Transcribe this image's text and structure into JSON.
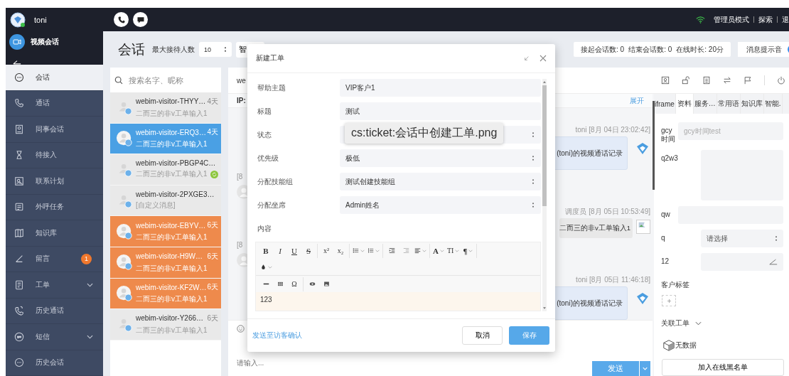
{
  "topbar": {
    "user": "toni",
    "menu": [
      {
        "label": "管理员模式"
      },
      {
        "label": "探索"
      },
      {
        "label": "退"
      }
    ]
  },
  "sidebar": {
    "video": "视频会话",
    "items": [
      {
        "label": "会话",
        "selected": true,
        "submenu": false
      },
      {
        "label": "通话",
        "selected": false,
        "submenu": false
      },
      {
        "label": "同事会话",
        "selected": false,
        "submenu": false
      },
      {
        "label": "待接入",
        "selected": false,
        "submenu": false
      },
      {
        "label": "联系计划",
        "selected": false,
        "submenu": false
      },
      {
        "label": "外呼任务",
        "selected": false,
        "submenu": false
      },
      {
        "label": "知识库",
        "selected": false,
        "submenu": false
      },
      {
        "label": "留言",
        "selected": false,
        "submenu": false,
        "badge": "1"
      },
      {
        "label": "工单",
        "selected": false,
        "submenu": true
      },
      {
        "label": "历史通话",
        "selected": false,
        "submenu": false
      },
      {
        "label": "短信",
        "selected": false,
        "submenu": true
      },
      {
        "label": "历史会话",
        "selected": false,
        "submenu": false
      }
    ]
  },
  "header": {
    "title": "会话",
    "max_label": "最大接待人数",
    "max_value": "10",
    "smart": "智",
    "stats": [
      "接起会话数: 0",
      "结束会话数: 0",
      "在线时长: 20分"
    ],
    "sound_label": "消息提示音",
    "sound_on": true
  },
  "conversations": {
    "search_placeholder": "搜索名字、昵称",
    "items": [
      {
        "name": "webim-visitor-THYY…",
        "time": "4天",
        "preview": "二而三的非v工单输入1",
        "selected": false,
        "alert": false,
        "transfer": false
      },
      {
        "name": "webim-visitor-ERQ3…",
        "time": "4天",
        "preview": "二而三的非v工单输入1",
        "selected": true,
        "alert": false,
        "transfer": false
      },
      {
        "name": "webim-visitor-PBGP4C…",
        "preview": "二而三的非v工单输入1",
        "selected": false,
        "alert": false,
        "transfer": true
      },
      {
        "name": "webim-visitor-2PXGE3…",
        "preview": "[自定义消息]",
        "selected": false,
        "alert": false,
        "transfer": false
      },
      {
        "name": "webim-visitor-EBYV…",
        "time": "6天",
        "preview": "二而三的非v工单输入1",
        "selected": false,
        "alert": true,
        "transfer": false
      },
      {
        "name": "webim-visitor-H9W…",
        "time": "6天",
        "preview": "二而三的非v工单输入1",
        "selected": false,
        "alert": true,
        "transfer": false
      },
      {
        "name": "webim-visitor-KF2W…",
        "time": "6天",
        "preview": "二而三的非v工单输入1",
        "selected": false,
        "alert": true,
        "transfer": false
      },
      {
        "name": "webim-visitor-Y266…",
        "time": "6天",
        "preview": "二而三的非v工单输入1",
        "selected": false,
        "alert": false,
        "transfer": false
      }
    ]
  },
  "chat": {
    "visitor": "we",
    "ip": "IP:",
    "expand": "展开",
    "messages": [
      {
        "kind": "call",
        "meta": "toni [8月 04日 23:02:42]",
        "text": "(toni)的视频通话记录"
      },
      {
        "kind": "visitor",
        "meta": "[8"
      },
      {
        "kind": "text",
        "meta": "调度员 [8月 05日 10:53:49]",
        "text": "二而三的非v工单输入1"
      },
      {
        "kind": "visitor",
        "meta": "[8"
      },
      {
        "kind": "call",
        "meta": "toni [8月 05日 11:46:18]",
        "text": "(toni)的视频通话记录"
      }
    ],
    "input_placeholder": "请输入...",
    "send": "发送"
  },
  "side_panel": {
    "tabs": [
      {
        "label": "iframe",
        "selected": false
      },
      {
        "label": "资料",
        "selected": true
      },
      {
        "label": "服务…",
        "selected": false
      },
      {
        "label": "常用语",
        "selected": false
      },
      {
        "label": "知识库",
        "selected": false
      },
      {
        "label": "智能.",
        "selected": false
      }
    ],
    "fields": [
      {
        "label": "gcy时间",
        "kind": "input",
        "placeholder": "gcy时间test"
      },
      {
        "label": "q2w3",
        "kind": "textarea"
      },
      {
        "label": "qw",
        "kind": "input"
      },
      {
        "label": "q",
        "kind": "select",
        "placeholder": "请选择"
      },
      {
        "label": "12",
        "kind": "edit"
      }
    ],
    "tags_label": "客户标签",
    "linked_label": "关联工单",
    "empty": "无数据",
    "blacklist": "加入在线黑名单"
  },
  "dialog": {
    "title": "新建工单",
    "fields": [
      {
        "label": "帮助主题",
        "kind": "input",
        "value": "VIP客户1"
      },
      {
        "label": "标题",
        "kind": "input",
        "value": "测试"
      },
      {
        "label": "状态",
        "kind": "select"
      },
      {
        "label": "优先级",
        "kind": "select",
        "value": "极低"
      },
      {
        "label": "分配技能组",
        "kind": "select",
        "value": "测试创建技能组"
      },
      {
        "label": "分配坐席",
        "kind": "select",
        "value": "Admin姓名"
      }
    ],
    "content_label": "内容",
    "toolbar": [
      [
        {
          "kind": "glyph",
          "label": "B",
          "dropdown": false
        },
        {
          "kind": "glyph",
          "label": "I",
          "dropdown": false
        },
        {
          "kind": "glyph",
          "label": "U",
          "dropdown": false
        },
        {
          "kind": "glyph",
          "label": "S",
          "dropdown": false
        },
        {
          "kind": "sep"
        },
        {
          "kind": "glyph",
          "label": "x²",
          "dropdown": false
        },
        {
          "kind": "glyph",
          "label": "x₂",
          "dropdown": false
        },
        {
          "kind": "sep"
        },
        {
          "kind": "icon",
          "dropdown": true
        },
        {
          "kind": "icon",
          "dropdown": true
        },
        {
          "kind": "sep"
        },
        {
          "kind": "icon",
          "dropdown": false
        },
        {
          "kind": "icon",
          "dropdown": false
        },
        {
          "kind": "icon",
          "dropdown": true
        },
        {
          "kind": "sep"
        },
        {
          "kind": "glyph",
          "label": "A",
          "dropdown": true
        },
        {
          "kind": "glyph",
          "label": "TI",
          "dropdown": true
        },
        {
          "kind": "glyph",
          "label": "¶",
          "dropdown": true
        },
        {
          "kind": "sep"
        }
      ],
      [
        {
          "kind": "icon",
          "dropdown": true
        }
      ],
      [
        {
          "kind": "icon",
          "dropdown": false
        },
        {
          "kind": "icon",
          "dropdown": false
        },
        {
          "kind": "glyph",
          "label": "Ω",
          "dropdown": false
        },
        {
          "kind": "sep"
        },
        {
          "kind": "icon",
          "dropdown": false
        },
        {
          "kind": "icon",
          "dropdown": false
        }
      ]
    ],
    "content": "123",
    "link": "发送至访客确认",
    "cancel": "取消",
    "save": "保存"
  },
  "tooltip": "cs:ticket:会话中创建工单.png"
}
